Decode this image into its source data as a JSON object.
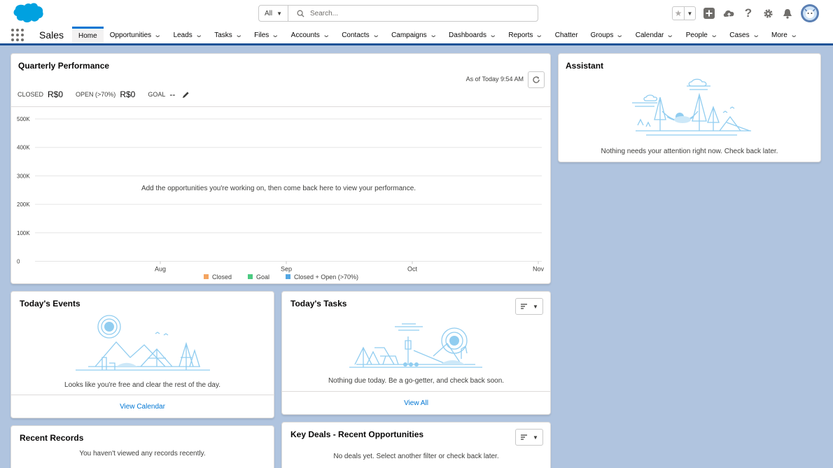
{
  "header": {
    "search_scope": "All",
    "search_placeholder": "Search..."
  },
  "nav": {
    "app_name": "Sales",
    "items": [
      {
        "label": "Home",
        "active": true,
        "dropdown": false
      },
      {
        "label": "Opportunities",
        "dropdown": true
      },
      {
        "label": "Leads",
        "dropdown": true
      },
      {
        "label": "Tasks",
        "dropdown": true
      },
      {
        "label": "Files",
        "dropdown": true
      },
      {
        "label": "Accounts",
        "dropdown": true
      },
      {
        "label": "Contacts",
        "dropdown": true
      },
      {
        "label": "Campaigns",
        "dropdown": true
      },
      {
        "label": "Dashboards",
        "dropdown": true
      },
      {
        "label": "Reports",
        "dropdown": true
      },
      {
        "label": "Chatter",
        "dropdown": false
      },
      {
        "label": "Groups",
        "dropdown": true
      },
      {
        "label": "Calendar",
        "dropdown": true
      },
      {
        "label": "People",
        "dropdown": true
      },
      {
        "label": "Cases",
        "dropdown": true
      },
      {
        "label": "More",
        "dropdown": true
      }
    ]
  },
  "quarterly": {
    "title": "Quarterly Performance",
    "as_of": "As of Today 9:54 AM",
    "closed_label": "CLOSED",
    "closed_value": "R$0",
    "open_label": "OPEN (>70%)",
    "open_value": "R$0",
    "goal_label": "GOAL",
    "goal_value": "--",
    "empty_message": "Add the opportunities you're working on, then come back here to view your performance."
  },
  "chart_data": {
    "type": "line",
    "x": [
      "Aug",
      "Sep",
      "Oct",
      "Nov"
    ],
    "y_ticks": [
      "0",
      "100K",
      "200K",
      "300K",
      "400K",
      "500K"
    ],
    "ylim": [
      0,
      500000
    ],
    "grid": true,
    "series": [
      {
        "name": "Closed",
        "color": "#f4a460",
        "values": []
      },
      {
        "name": "Goal",
        "color": "#4bca81",
        "values": []
      },
      {
        "name": "Closed + Open (>70%)",
        "color": "#54a7e3",
        "values": []
      }
    ],
    "legend_position": "bottom"
  },
  "assistant": {
    "title": "Assistant",
    "empty_message": "Nothing needs your attention right now. Check back later."
  },
  "events": {
    "title": "Today's Events",
    "empty_message": "Looks like you're free and clear the rest of the day.",
    "link": "View Calendar"
  },
  "tasks": {
    "title": "Today's Tasks",
    "empty_message": "Nothing due today. Be a go-getter, and check back soon.",
    "link": "View All"
  },
  "records": {
    "title": "Recent Records",
    "empty_message": "You haven't viewed any records recently."
  },
  "deals": {
    "title": "Key Deals - Recent Opportunities",
    "empty_message": "No deals yet. Select another filter or check back later."
  },
  "colors": {
    "brand": "#0176d3",
    "nav_border": "#1b5297",
    "page_bg": "#b0c4df"
  }
}
